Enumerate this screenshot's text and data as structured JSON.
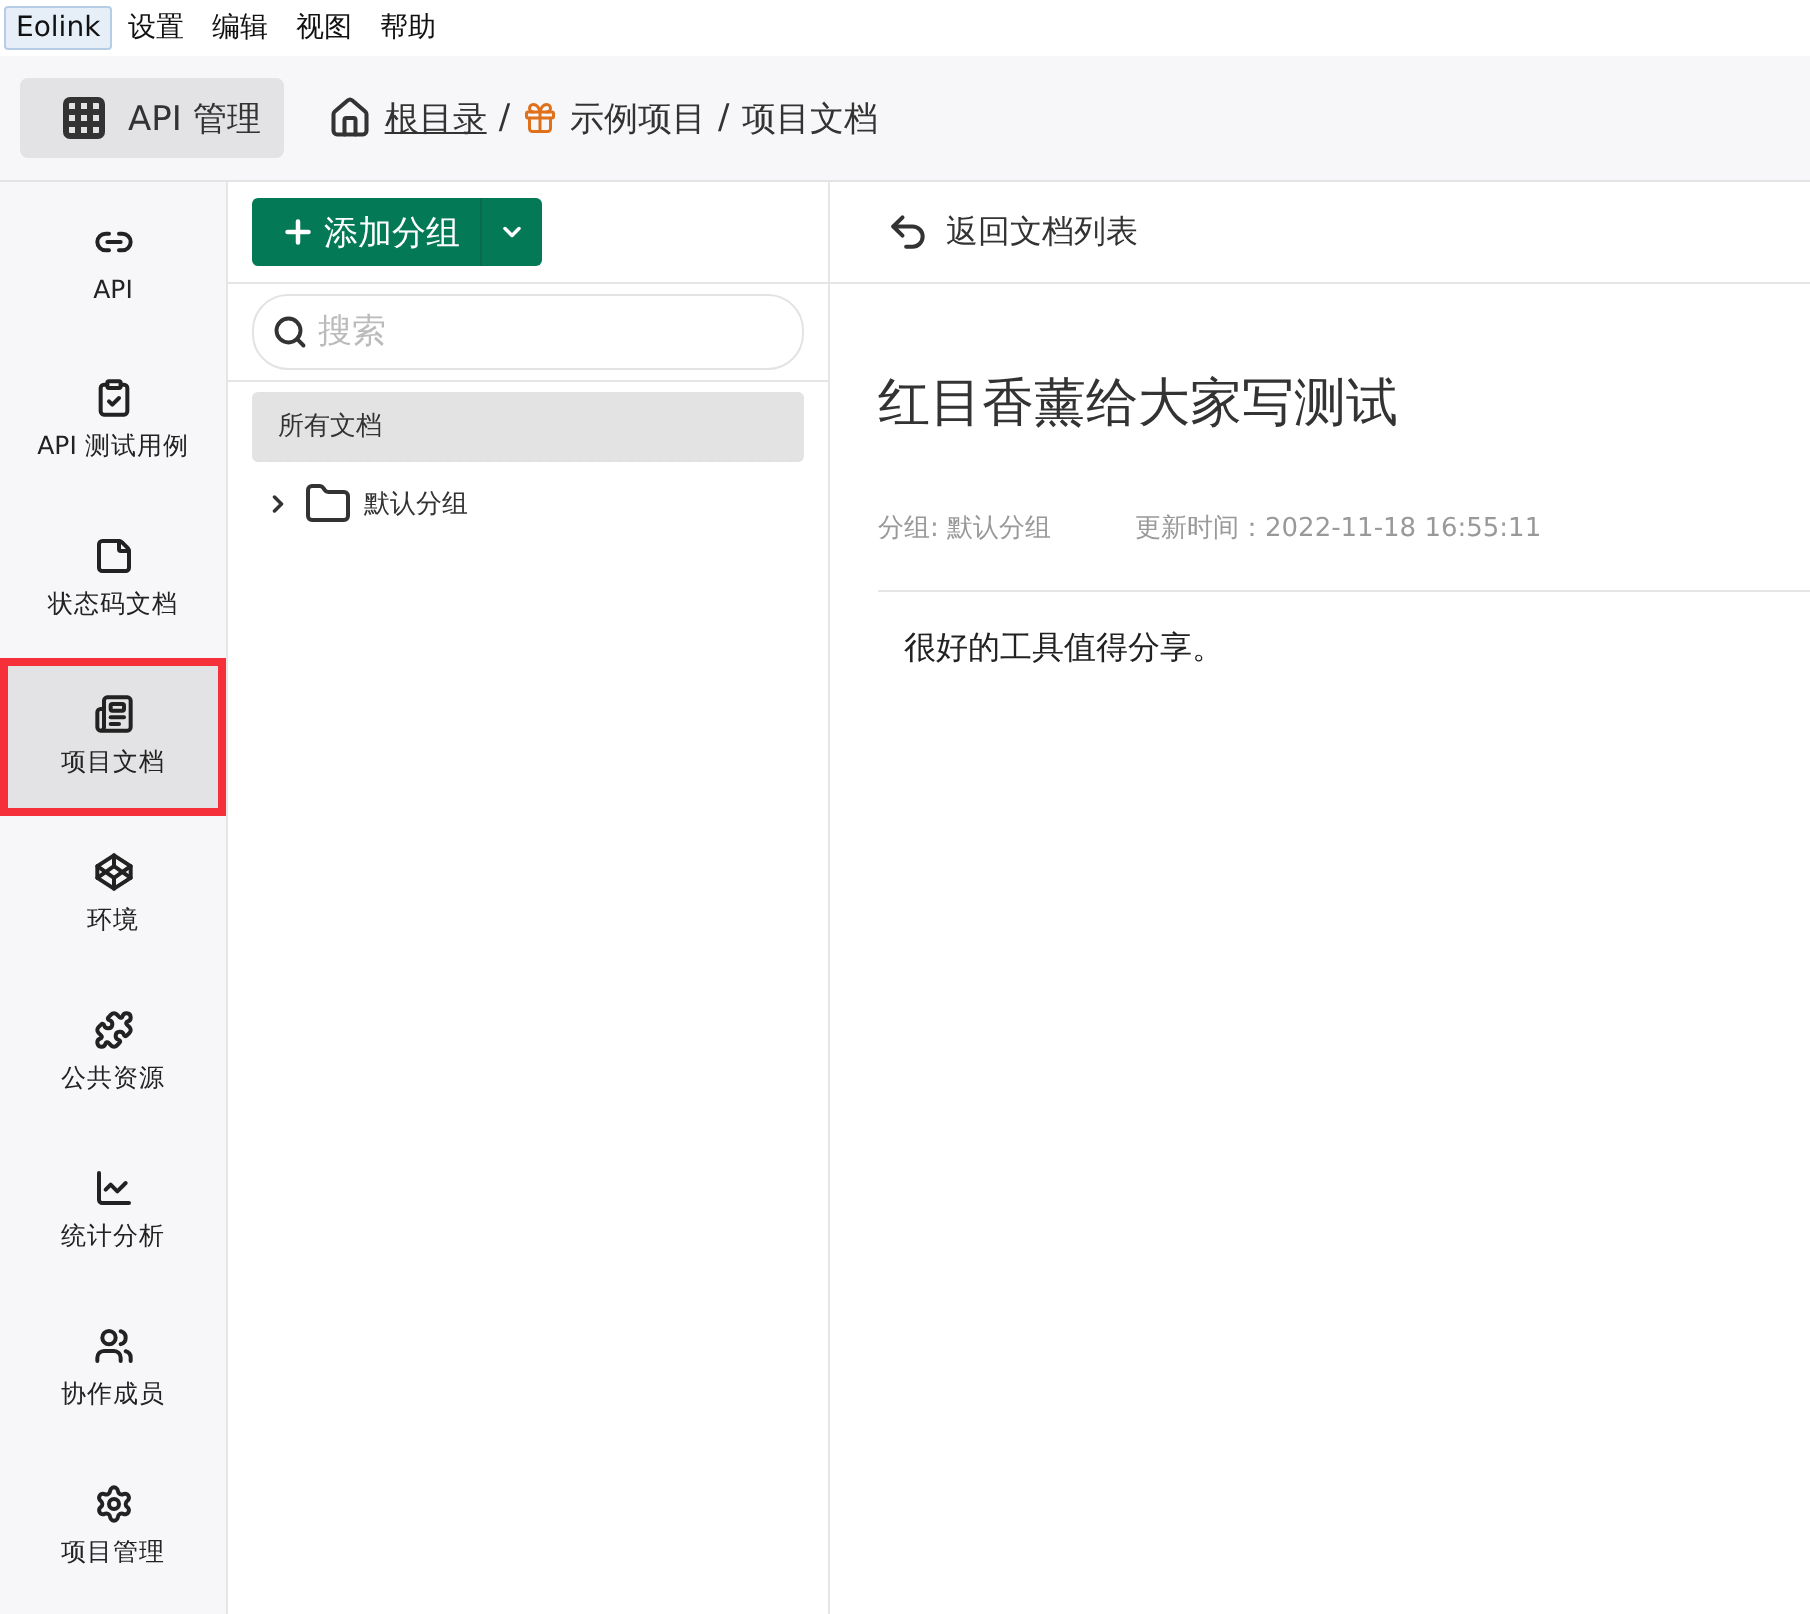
{
  "menu_bar": [
    {
      "label": "Eolink",
      "selected": true
    },
    {
      "label": "设置",
      "selected": false
    },
    {
      "label": "编辑",
      "selected": false
    },
    {
      "label": "视图",
      "selected": false
    },
    {
      "label": "帮助",
      "selected": false
    }
  ],
  "top_bar": {
    "app_button": "API 管理",
    "breadcrumb": [
      {
        "label": "根目录",
        "link": true
      },
      {
        "label": "/",
        "link": false
      },
      {
        "label": "示例项目",
        "link": false
      },
      {
        "label": "/",
        "link": false
      },
      {
        "label": "项目文档",
        "link": false
      }
    ]
  },
  "sidebar": {
    "items": [
      {
        "label": "API",
        "selected": false,
        "annotated": false
      },
      {
        "label": "API 测试用例",
        "selected": false,
        "annotated": false
      },
      {
        "label": "状态码文档",
        "selected": false,
        "annotated": false
      },
      {
        "label": "项目文档",
        "selected": true,
        "annotated": true
      },
      {
        "label": "环境",
        "selected": false,
        "annotated": false
      },
      {
        "label": "公共资源",
        "selected": false,
        "annotated": false
      },
      {
        "label": "统计分析",
        "selected": false,
        "annotated": false
      },
      {
        "label": "协作成员",
        "selected": false,
        "annotated": false
      },
      {
        "label": "项目管理",
        "selected": false,
        "annotated": false
      }
    ]
  },
  "group_panel": {
    "add_button": "添加分组",
    "search": {
      "placeholder": "搜索"
    },
    "all_docs": {
      "label": "所有文档",
      "selected": true
    },
    "groups": [
      {
        "label": "默认分组",
        "expanded": false
      }
    ]
  },
  "document": {
    "back_link": "返回文档列表",
    "title": "红目香薰给大家写测试",
    "group": "分组: 默认分组",
    "updated": "更新时间：2022-11-18 16:55:11",
    "body": "很好的工具值得分享。"
  }
}
